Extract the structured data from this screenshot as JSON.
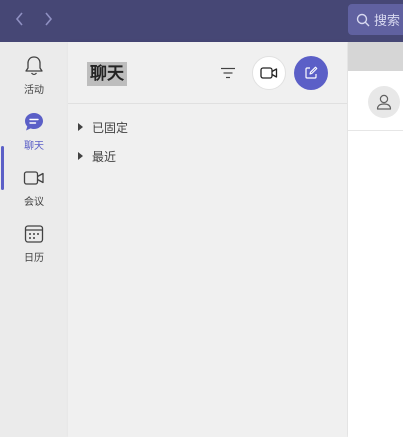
{
  "titlebar": {
    "back_icon": "chevron-left-icon",
    "forward_icon": "chevron-right-icon",
    "search_placeholder": "搜索"
  },
  "rail": {
    "items": [
      {
        "label": "活动",
        "icon": "bell-icon",
        "active": false
      },
      {
        "label": "聊天",
        "icon": "chat-icon",
        "active": true
      },
      {
        "label": "会议",
        "icon": "video-camera-icon",
        "active": false
      },
      {
        "label": "日历",
        "icon": "calendar-icon",
        "active": false
      }
    ]
  },
  "chat_panel": {
    "title": "聊天",
    "filter_icon": "filter-icon",
    "video_icon": "video-camera-icon",
    "compose_icon": "compose-icon",
    "sections": [
      {
        "label": "已固定"
      },
      {
        "label": "最近"
      }
    ]
  },
  "content": {
    "avatar_icon": "person-icon"
  },
  "colors": {
    "titlebar": "#464775",
    "accent": "#5b5fc7",
    "rail_bg": "#ebebeb",
    "panel_bg": "#f0f0f0"
  }
}
